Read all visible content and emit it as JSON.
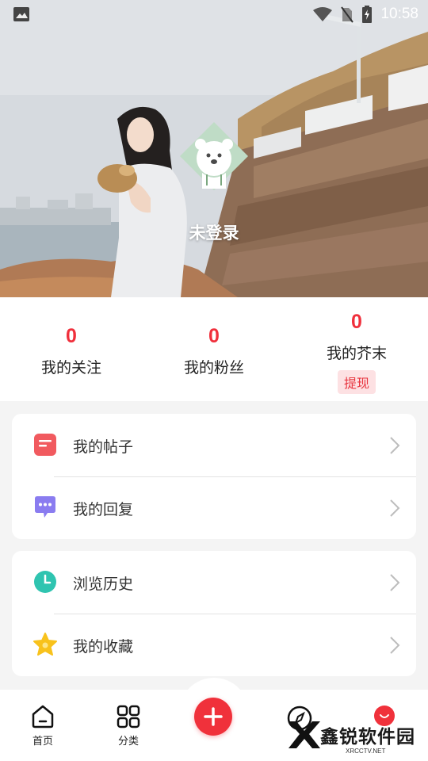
{
  "status_bar": {
    "time": "10:58",
    "icons": [
      "image-icon",
      "wifi-icon",
      "no-sim-icon",
      "battery-charging-icon"
    ]
  },
  "profile": {
    "login_status": "未登录",
    "avatar_icon": "polar-bear-avatar-icon"
  },
  "stats": [
    {
      "value": "0",
      "label": "我的关注"
    },
    {
      "value": "0",
      "label": "我的粉丝"
    },
    {
      "value": "0",
      "label": "我的芥末",
      "action": "提现"
    }
  ],
  "menu_groups": [
    [
      {
        "label": "我的帖子",
        "icon": "post-icon",
        "color": "#f15a5f"
      },
      {
        "label": "我的回复",
        "icon": "reply-icon",
        "color": "#8a7cf0"
      }
    ],
    [
      {
        "label": "浏览历史",
        "icon": "history-clock-icon",
        "color": "#2fc4b0"
      },
      {
        "label": "我的收藏",
        "icon": "star-icon",
        "color": "#f8c21c"
      }
    ]
  ],
  "bottom_nav": {
    "items": [
      {
        "label": "首页",
        "icon": "home-icon"
      },
      {
        "label": "分类",
        "icon": "grid-icon"
      },
      {
        "label": "",
        "icon": "add-icon"
      },
      {
        "label": "",
        "icon": "compass-icon"
      },
      {
        "label": "",
        "icon": "profile-icon"
      }
    ]
  },
  "watermark": {
    "title": "鑫锐软件园",
    "subtitle": "XRCCTV.NET"
  },
  "colors": {
    "accent": "#f0303c",
    "badge_bg": "#fde1e3",
    "page_bg": "#f4f4f4"
  }
}
